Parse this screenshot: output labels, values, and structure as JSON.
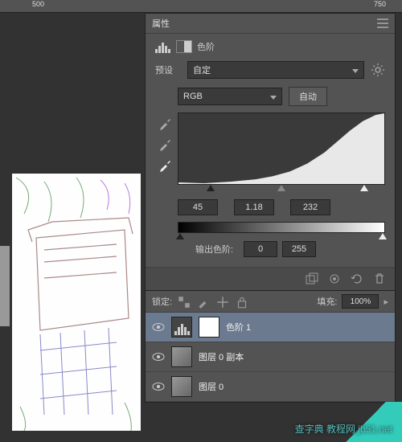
{
  "ruler": {
    "marks": [
      "500",
      "750"
    ]
  },
  "properties_panel": {
    "tab_title": "属性",
    "adjustment_title": "色阶",
    "preset_label": "预设",
    "preset_value": "自定",
    "channel_value": "RGB",
    "auto_button": "自动",
    "input_levels": {
      "shadows": "45",
      "midtones": "1.18",
      "highlights": "232"
    },
    "output_label": "输出色阶:",
    "output_levels": {
      "black": "0",
      "white": "255"
    }
  },
  "layers_panel": {
    "lock_label": "锁定:",
    "fill_label": "填充:",
    "fill_value": "100%",
    "layers": [
      {
        "name": "色阶 1",
        "type": "adjustment",
        "selected": true
      },
      {
        "name": "图层 0 副本",
        "type": "image",
        "selected": false
      },
      {
        "name": "图层 0",
        "type": "image",
        "selected": false
      }
    ]
  },
  "watermark": "查字典 教程网\njb51.net"
}
